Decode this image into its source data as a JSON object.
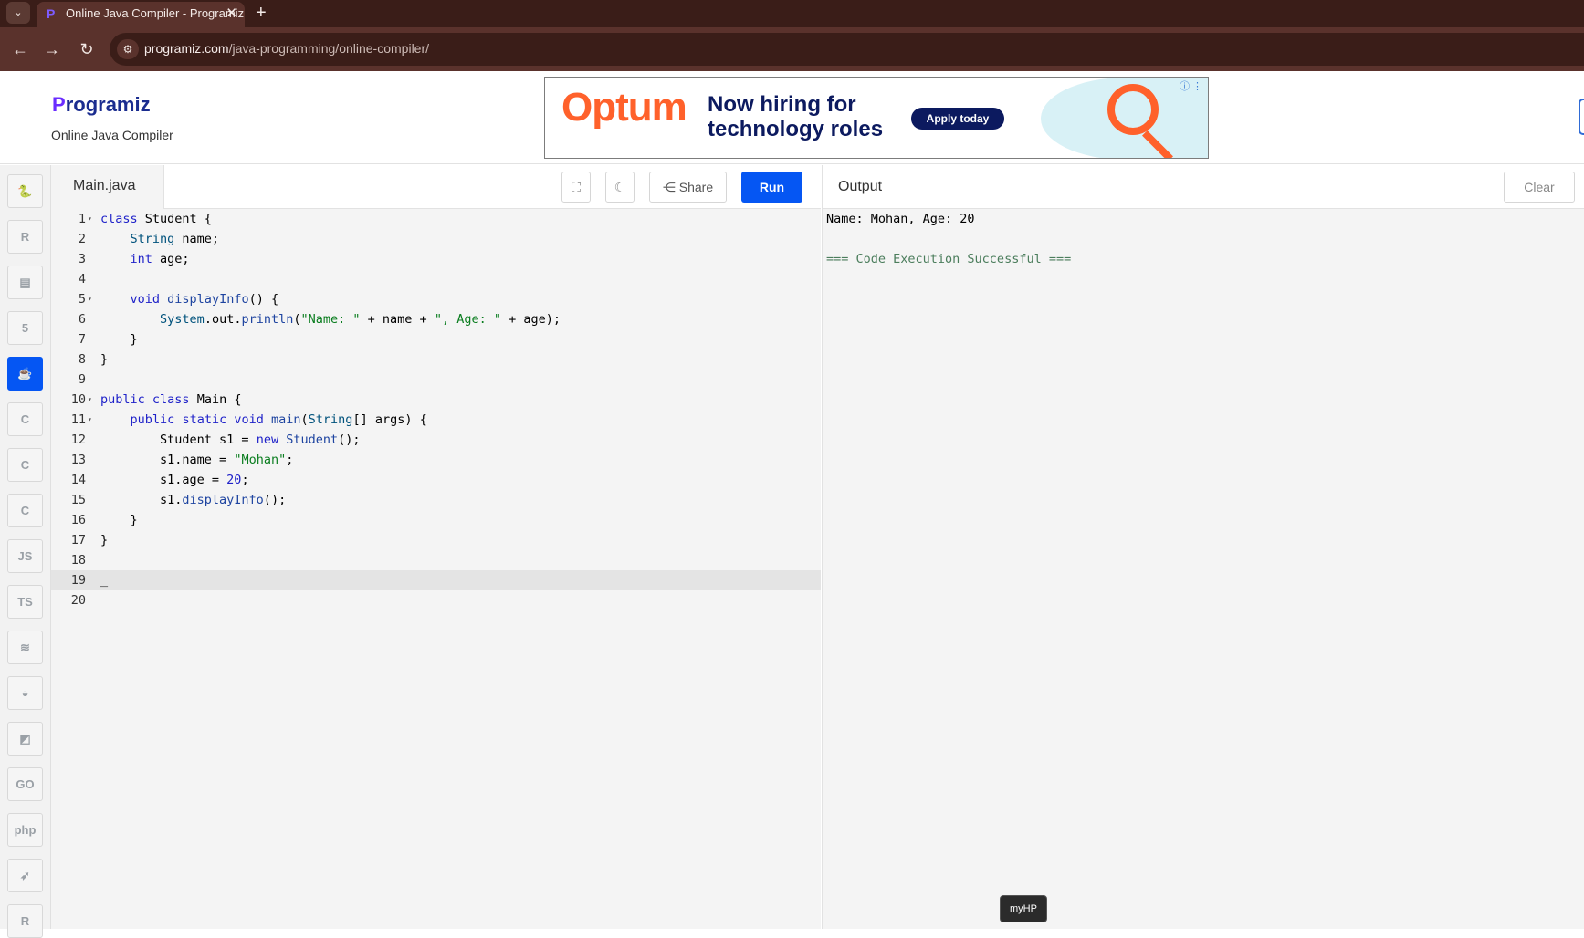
{
  "browser": {
    "tab_title": "Online Java Compiler - Programiz",
    "tab_favicon": "P",
    "tab_close": "✕",
    "new_tab": "+",
    "tab_menu": "⌄",
    "back": "←",
    "forward": "→",
    "reload": "↻",
    "site_info": "⚙",
    "url_domain": "programiz.com",
    "url_path": "/java-programming/online-compiler/"
  },
  "header": {
    "logo_p": "P",
    "logo_rest": "rogramiz",
    "subtitle": "Online Java Compiler"
  },
  "ad": {
    "brand": "Optum",
    "headline": "Now hiring for technology roles",
    "cta": "Apply today",
    "info": "ⓘ ⋮",
    "brand_color": "#ff612b",
    "navy": "#0c1a5f"
  },
  "sidebar": {
    "items": [
      {
        "name": "python-icon",
        "glyph": "🐍"
      },
      {
        "name": "r-icon",
        "glyph": "R"
      },
      {
        "name": "sql-icon",
        "glyph": "▤"
      },
      {
        "name": "html-icon",
        "glyph": "5"
      },
      {
        "name": "java-icon",
        "glyph": "☕"
      },
      {
        "name": "c-icon",
        "glyph": "C"
      },
      {
        "name": "cpp-icon",
        "glyph": "C"
      },
      {
        "name": "csharp-icon",
        "glyph": "C"
      },
      {
        "name": "javascript-icon",
        "glyph": "JS"
      },
      {
        "name": "typescript-icon",
        "glyph": "TS"
      },
      {
        "name": "scala-icon",
        "glyph": "≋"
      },
      {
        "name": "kotlin-icon",
        "glyph": "◒"
      },
      {
        "name": "dart-icon",
        "glyph": "◩"
      },
      {
        "name": "go-icon",
        "glyph": "GO"
      },
      {
        "name": "php-icon",
        "glyph": "php"
      },
      {
        "name": "swift-icon",
        "glyph": "➶"
      },
      {
        "name": "rust-icon",
        "glyph": "R"
      }
    ]
  },
  "editor": {
    "filename": "Main.java",
    "fullscreen_icon": "⛶",
    "theme_icon": "☾",
    "share_label": "Share",
    "share_icon": "⋲",
    "run_label": "Run"
  },
  "code_lines": [
    {
      "n": "1",
      "fold": true,
      "html": "<span class=\"kw\">class</span> Student {"
    },
    {
      "n": "2",
      "fold": false,
      "html": "    <span class=\"ty\">String</span> name;"
    },
    {
      "n": "3",
      "fold": false,
      "html": "    <span class=\"kw\">int</span> age;"
    },
    {
      "n": "4",
      "fold": false,
      "html": ""
    },
    {
      "n": "5",
      "fold": true,
      "html": "    <span class=\"kw\">void</span> <span class=\"fn\">displayInfo</span>() {"
    },
    {
      "n": "6",
      "fold": false,
      "html": "        <span class=\"ty\">System</span>.out.<span class=\"fn\">println</span>(<span class=\"str\">\"Name: \"</span> + name + <span class=\"str\">\", Age: \"</span> + age);"
    },
    {
      "n": "7",
      "fold": false,
      "html": "    }"
    },
    {
      "n": "8",
      "fold": false,
      "html": "}"
    },
    {
      "n": "9",
      "fold": false,
      "html": ""
    },
    {
      "n": "10",
      "fold": true,
      "html": "<span class=\"kw\">public</span> <span class=\"kw\">class</span> Main {"
    },
    {
      "n": "11",
      "fold": true,
      "html": "    <span class=\"kw\">public</span> <span class=\"kw\">static</span> <span class=\"kw\">void</span> <span class=\"fn\">main</span>(<span class=\"ty\">String</span>[] args) {"
    },
    {
      "n": "12",
      "fold": false,
      "html": "        Student s1 = <span class=\"kw\">new</span> <span class=\"fn\">Student</span>();"
    },
    {
      "n": "13",
      "fold": false,
      "html": "        s1.name = <span class=\"str\">\"Mohan\"</span>;"
    },
    {
      "n": "14",
      "fold": false,
      "html": "        s1.age = <span class=\"num\">20</span>;"
    },
    {
      "n": "15",
      "fold": false,
      "html": "        s1.<span class=\"fn\">displayInfo</span>();"
    },
    {
      "n": "16",
      "fold": false,
      "html": "    }"
    },
    {
      "n": "17",
      "fold": false,
      "html": "}"
    },
    {
      "n": "18",
      "fold": false,
      "html": ""
    },
    {
      "n": "19",
      "fold": false,
      "html": "_",
      "active": true
    },
    {
      "n": "20",
      "fold": false,
      "html": ""
    }
  ],
  "output": {
    "title": "Output",
    "clear_label": "Clear",
    "lines": [
      "Name: Mohan, Age: 20",
      "",
      "=== Code Execution Successful ==="
    ]
  },
  "tooltip": "myHP"
}
